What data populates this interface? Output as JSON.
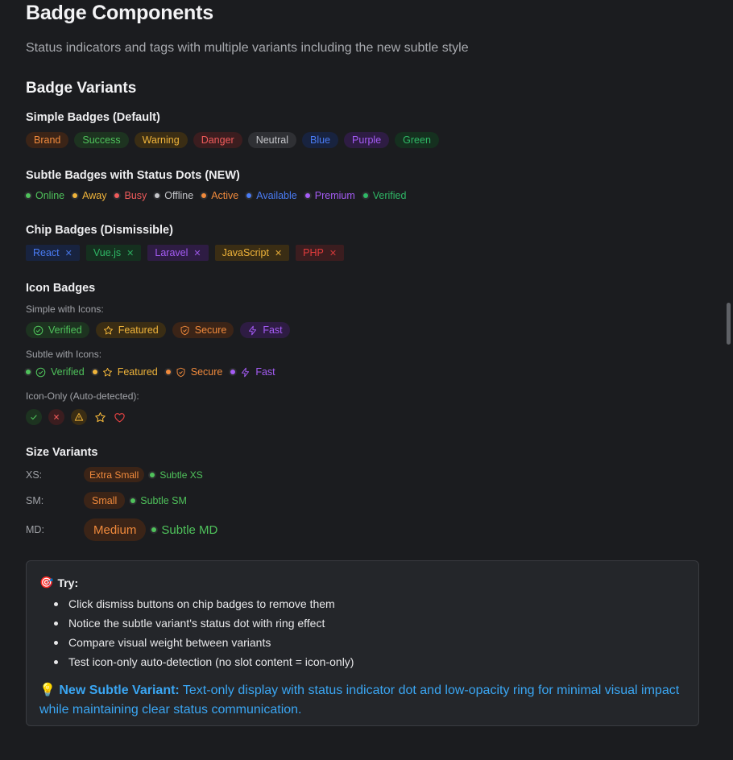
{
  "page": {
    "title": "Badge Components",
    "lead": "Status indicators and tags with multiple variants including the new subtle style",
    "section_title": "Badge Variants"
  },
  "simple": {
    "heading": "Simple Badges (Default)",
    "items": [
      "Brand",
      "Success",
      "Warning",
      "Danger",
      "Neutral",
      "Blue",
      "Purple",
      "Green"
    ]
  },
  "subtle": {
    "heading": "Subtle Badges with Status Dots (NEW)",
    "items": [
      {
        "label": "Online",
        "color": "#4fc25b"
      },
      {
        "label": "Away",
        "color": "#f0b43a"
      },
      {
        "label": "Busy",
        "color": "#ef5b5b"
      },
      {
        "label": "Offline",
        "color": "#c5c6ca"
      },
      {
        "label": "Active",
        "color": "#f08a3c"
      },
      {
        "label": "Available",
        "color": "#4a7cf5"
      },
      {
        "label": "Premium",
        "color": "#a55cf5"
      },
      {
        "label": "Verified",
        "color": "#2fb866"
      }
    ]
  },
  "chips": {
    "heading": "Chip Badges (Dismissible)",
    "items": [
      "React",
      "Vue.js",
      "Laravel",
      "JavaScript",
      "PHP"
    ],
    "dismiss_glyph": "✕"
  },
  "icon_badges": {
    "heading": "Icon Badges",
    "simple_label": "Simple with Icons:",
    "subtle_label": "Subtle with Icons:",
    "icononly_label": "Icon-Only (Auto-detected):",
    "items": [
      {
        "label": "Verified",
        "icon": "check-circle-icon"
      },
      {
        "label": "Featured",
        "icon": "star-icon"
      },
      {
        "label": "Secure",
        "icon": "shield-icon"
      },
      {
        "label": "Fast",
        "icon": "bolt-icon"
      }
    ],
    "icon_only": [
      "check-icon",
      "x-icon",
      "warning-icon",
      "star-icon",
      "heart-icon"
    ]
  },
  "sizes": {
    "heading": "Size Variants",
    "rows": [
      {
        "label": "XS:",
        "badge": "Extra Small",
        "subtle": "Subtle XS"
      },
      {
        "label": "SM:",
        "badge": "Small",
        "subtle": "Subtle SM"
      },
      {
        "label": "MD:",
        "badge": "Medium",
        "subtle": "Subtle MD"
      }
    ]
  },
  "try": {
    "emoji": "🎯",
    "title": "Try:",
    "items": [
      "Click dismiss buttons on chip badges to remove them",
      "Notice the subtle variant's status dot with ring effect",
      "Compare visual weight between variants",
      "Test icon-only auto-detection (no slot content = icon-only)"
    ],
    "note_emoji": "💡",
    "note_strong": "New Subtle Variant:",
    "note_text": " Text-only display with status indicator dot and low-opacity ring for minimal visual impact while maintaining clear status communication."
  },
  "colors": {
    "accent_orange": "#f08a3c",
    "success": "#4fc25b",
    "link_blue": "#3aa6f3"
  }
}
